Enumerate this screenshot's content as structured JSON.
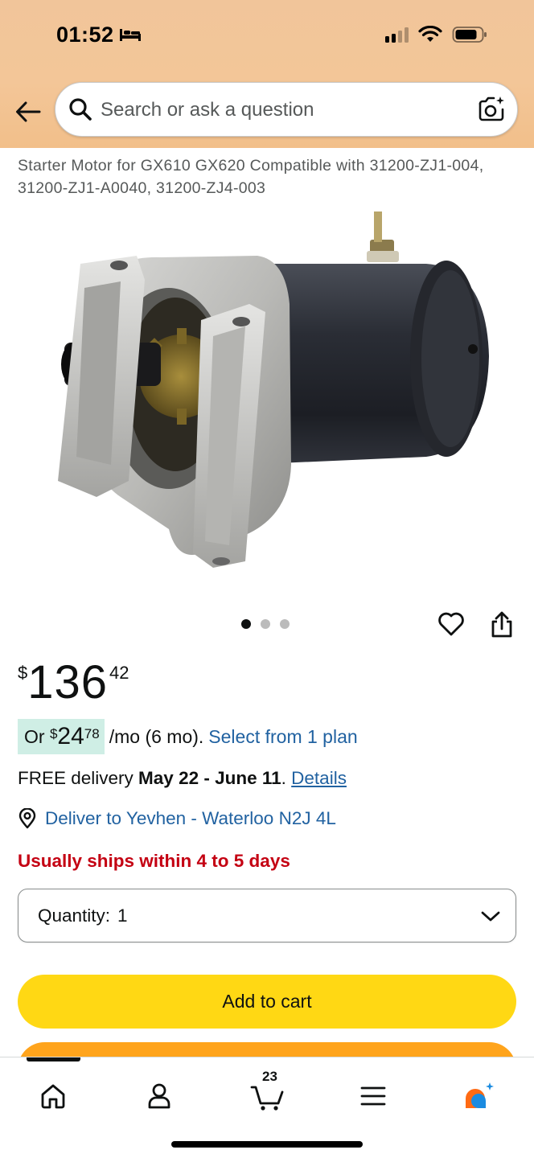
{
  "status_bar": {
    "time": "01:52"
  },
  "search": {
    "placeholder": "Search or ask a question"
  },
  "product": {
    "title": "Starter Motor for GX610 GX620 Compatible with 31200-ZJ1-004, 31200-ZJ1-A0040, 31200-ZJ4-003",
    "image_count": 3,
    "active_image_index": 0
  },
  "price": {
    "symbol": "$",
    "whole": "136",
    "fraction": "42"
  },
  "installment": {
    "prefix": "Or ",
    "symbol": "$",
    "whole": "24",
    "fraction": "78",
    "suffix": "/mo (6 mo).",
    "link": "Select from 1 plan"
  },
  "delivery": {
    "prefix": "FREE delivery ",
    "dates": "May 22 - June 11",
    "period": ". ",
    "details_link": "Details"
  },
  "deliver_to": {
    "label": "Deliver to Yevhen - Waterloo N2J 4L"
  },
  "availability": "Usually ships within 4 to 5 days",
  "quantity": {
    "label": "Quantity:",
    "value": "1"
  },
  "buttons": {
    "add_to_cart": "Add to cart"
  },
  "bottom_nav": {
    "cart_count": "23",
    "items": [
      "home-icon",
      "account-icon",
      "cart-icon",
      "menu-icon",
      "rufus-icon"
    ]
  },
  "colors": {
    "header": "#f3c698",
    "link": "#2162a1",
    "price_text": "#0f1111",
    "installment_bg": "#cfeee5",
    "availability": "#c40012",
    "add_to_cart": "#ffd814",
    "buy_now": "#ffa41c",
    "rufus_orange": "#ff6a13",
    "rufus_blue": "#1b8be0"
  }
}
